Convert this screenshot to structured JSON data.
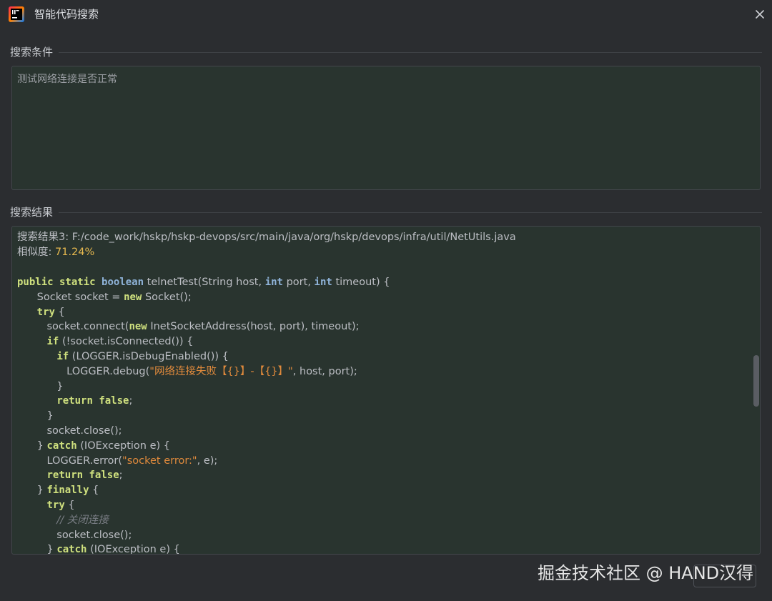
{
  "window": {
    "title": "智能代码搜索"
  },
  "search": {
    "label": "搜索条件",
    "query": "测试网络连接是否正常"
  },
  "results": {
    "label": "搜索结果",
    "header_line": "搜索结果3: F:/code_work/hskp/hskp-devops/src/main/java/org/hskp/devops/infra/util/NetUtils.java",
    "similarity_label": "相似度: ",
    "similarity_value": "71.24%"
  },
  "watermark": "掘金技术社区 @ HAND汉得",
  "colors": {
    "background": "#2b2d30",
    "editor_background": "#29342f",
    "keyword": "#cfe07e",
    "type": "#8fb3d9",
    "string": "#e08a3c",
    "number": "#e5b84f"
  }
}
